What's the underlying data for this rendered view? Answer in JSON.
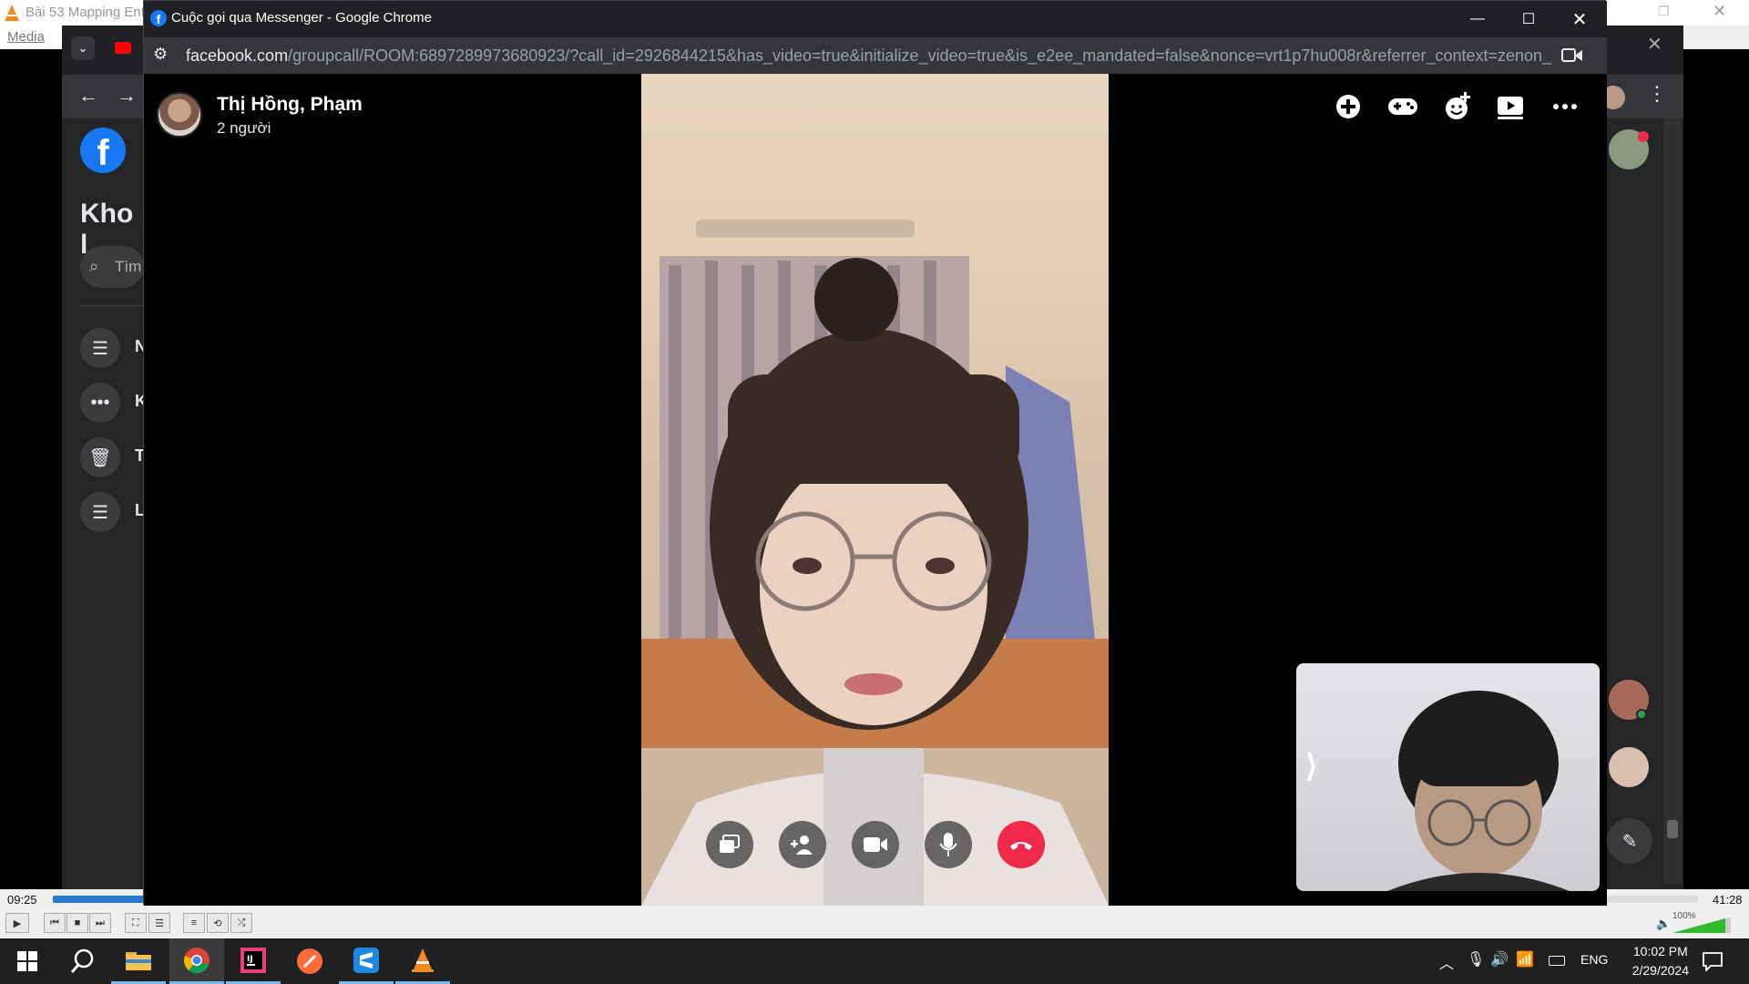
{
  "vlc": {
    "title": "Bài 53 Mapping Ent",
    "menu_media": "Media",
    "time_elapsed": "09:25",
    "time_total": "41:28",
    "volume": "100%",
    "progress_fraction": 0.227
  },
  "bg_browser": {
    "heading": "Kho l",
    "search_placeholder": "Tìm",
    "side_items": [
      {
        "icon": "list-icon",
        "letter": "N"
      },
      {
        "icon": "more-icon",
        "letter": "K"
      },
      {
        "icon": "trash-icon",
        "letter": "T"
      },
      {
        "icon": "list-icon",
        "letter": "L"
      }
    ]
  },
  "call_window": {
    "title": "Cuộc gọi qua Messenger - Google Chrome",
    "url_host": "facebook.com",
    "url_path": "/groupcall/ROOM:6897289973680923/?call_id=2926844215&has_video=true&initialize_video=true&is_e2ee_mandated=false&nonce=vrt1p7hu008r&referrer_context=zenon_prec...",
    "caller_name": "Thị Hồng, Phạm",
    "participant_count": "2 người",
    "top_actions": [
      "add-icon",
      "game-controller-icon",
      "emoji-add-icon",
      "play-video-icon",
      "more-icon"
    ],
    "controls": [
      "screen-share-icon",
      "add-person-icon",
      "camera-icon",
      "microphone-icon",
      "end-call-icon"
    ],
    "self_view_toggle": "⟩"
  },
  "taskbar": {
    "apps": [
      "windows-start-icon",
      "search-icon",
      "file-explorer-icon",
      "chrome-icon",
      "intellij-icon",
      "postman-icon",
      "sublime-icon",
      "vlc-icon"
    ],
    "lang": "ENG",
    "time": "10:02 PM",
    "date": "2/29/2024"
  },
  "colors": {
    "end_call": "#f02849",
    "facebook_blue": "#1877f2",
    "taskbar": "#202020"
  }
}
